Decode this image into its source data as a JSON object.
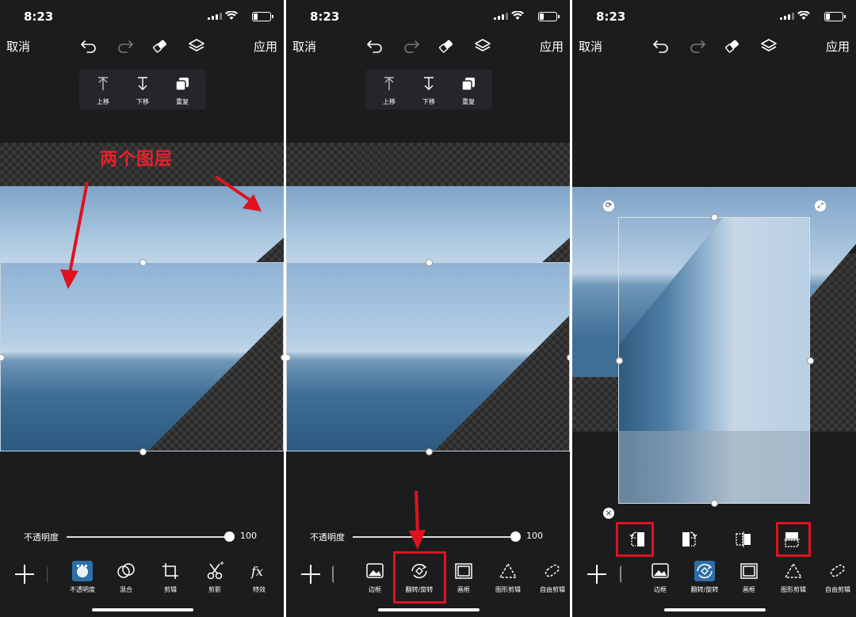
{
  "status": {
    "time": "8:23"
  },
  "navbar": {
    "cancel": "取消",
    "apply": "应用"
  },
  "context_menu": {
    "up": "上移",
    "down": "下移",
    "duplicate": "重复"
  },
  "annotation": {
    "text": "两个图层"
  },
  "opacity": {
    "label": "不透明度",
    "value": "100",
    "level": 1.0
  },
  "toolbar1": {
    "opacity": "不透明度",
    "blend": "混合",
    "crop": "剪辑",
    "shadow": "剪影",
    "effects": "特效"
  },
  "toolbar2": {
    "border": "边框",
    "flip_rotate": "翻转/旋转",
    "frame": "画框",
    "shape_crop": "图形剪辑",
    "free_crop": "自由剪辑"
  },
  "colors": {
    "annotation_red": "#e0121f",
    "active_blue": "#2e6fa8",
    "background": "#1c1c1e"
  }
}
